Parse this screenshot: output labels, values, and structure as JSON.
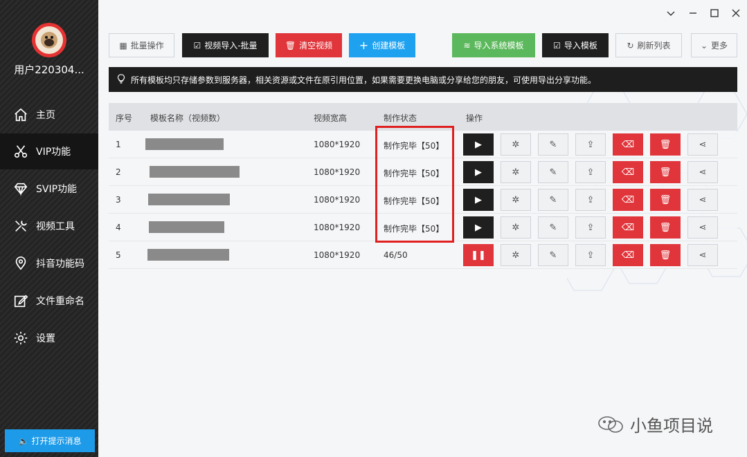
{
  "user": {
    "name": "用户220304..."
  },
  "sidebar": {
    "items": [
      {
        "label": "主页",
        "icon": "home-icon"
      },
      {
        "label": "VIP功能",
        "icon": "scissors-icon",
        "active": true
      },
      {
        "label": "SVIP功能",
        "icon": "diamond-icon"
      },
      {
        "label": "视频工具",
        "icon": "tools-icon"
      },
      {
        "label": "抖音功能码",
        "icon": "location-icon"
      },
      {
        "label": "文件重命名",
        "icon": "edit-icon"
      },
      {
        "label": "设置",
        "icon": "gear-icon"
      }
    ],
    "notify_label": "打开提示消息"
  },
  "window": {
    "minimize": "−",
    "maximize": "☐",
    "close": "✕",
    "collapse": "⌄"
  },
  "toolbar": {
    "batch_label": "批量操作",
    "import_batch_label": "视频导入-批量",
    "clear_label": "清空视频",
    "create_label": "创建模板",
    "import_system_label": "导入系统模板",
    "import_template_label": "导入模板",
    "refresh_label": "刷新列表",
    "more_label": "更多"
  },
  "notice": {
    "text": "所有模板均只存储参数到服务器，相关资源或文件在原引用位置，如果需要更换电脑或分享给您的朋友，可使用导出分享功能。"
  },
  "table": {
    "headers": {
      "index": "序号",
      "name": "模板名称（视频数）",
      "size": "视频宽高",
      "status": "制作状态",
      "actions": "操作"
    },
    "rows": [
      {
        "index": "1",
        "size": "1080*1920",
        "status": "制作完毕【50】",
        "state": "done"
      },
      {
        "index": "2",
        "size": "1080*1920",
        "status": "制作完毕【50】",
        "state": "done"
      },
      {
        "index": "3",
        "size": "1080*1920",
        "status": "制作完毕【50】",
        "state": "done"
      },
      {
        "index": "4",
        "size": "1080*1920",
        "status": "制作完毕【50】",
        "state": "done"
      },
      {
        "index": "5",
        "size": "1080*1920",
        "status": "46/50",
        "state": "running"
      }
    ]
  },
  "watermark": {
    "text": "小鱼项目说"
  },
  "colors": {
    "accent_blue": "#1ea2f0",
    "danger_red": "#e0353b",
    "success_green": "#5cb85c",
    "dark": "#1f1f1f"
  }
}
